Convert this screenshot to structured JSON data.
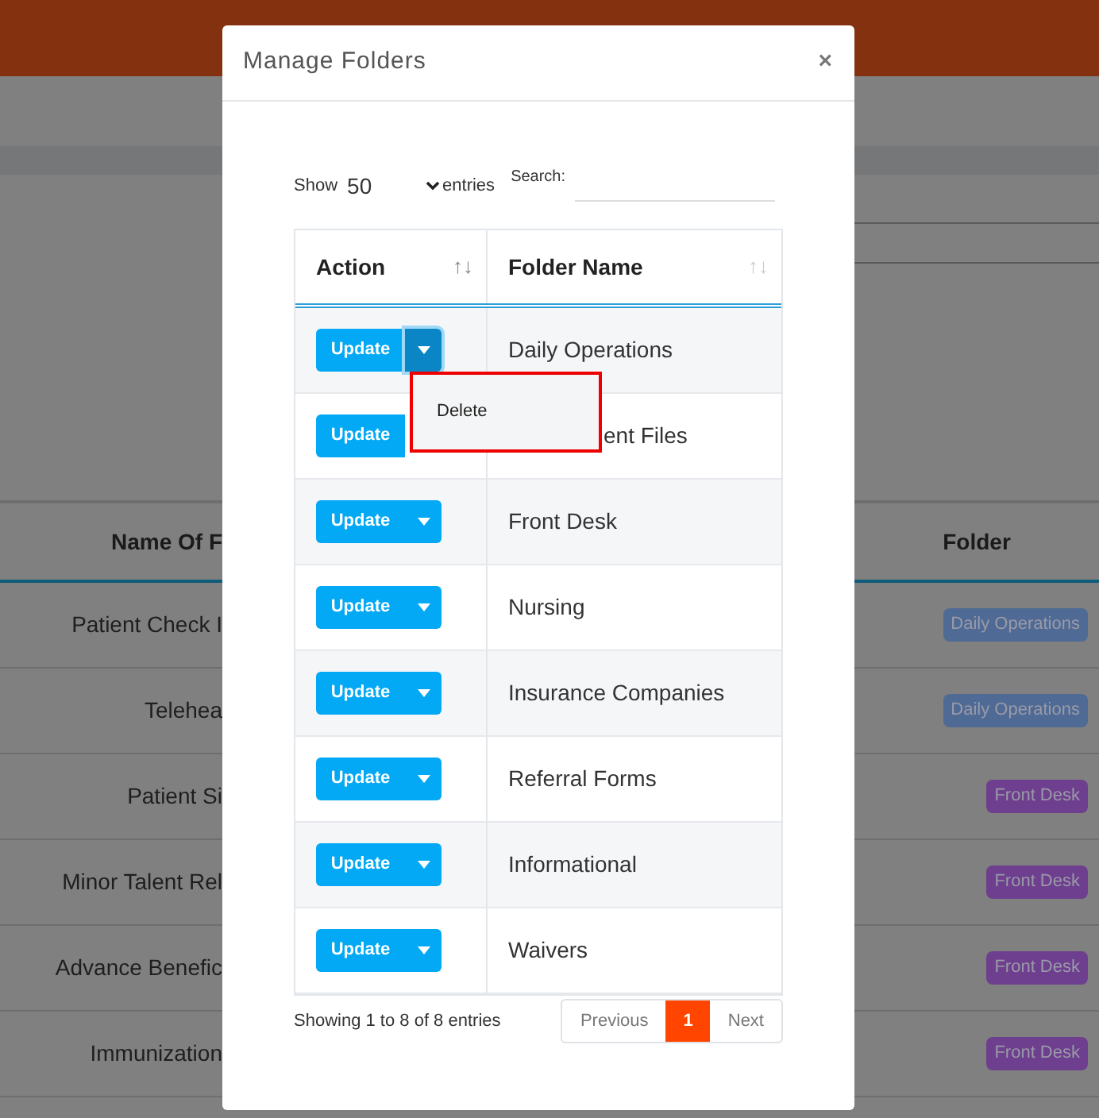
{
  "background": {
    "table": {
      "columns": [
        "Name Of F",
        "Folder"
      ],
      "rows": [
        {
          "name": "Patient Check I",
          "folder": "Daily Operations",
          "color": "#4f6a94"
        },
        {
          "name": "Telehea",
          "folder": "Daily Operations",
          "color": "#4f6a94"
        },
        {
          "name": "Patient Si",
          "folder": "Front Desk",
          "color": "#6e3f8e"
        },
        {
          "name": "Minor Talent Rel",
          "folder": "Front Desk",
          "color": "#6e3f8e"
        },
        {
          "name": "Advance Benefic",
          "folder": "Front Desk",
          "color": "#6e3f8e"
        },
        {
          "name": "Immunization",
          "folder": "Front Desk",
          "color": "#6e3f8e"
        }
      ]
    }
  },
  "modal": {
    "title": "Manage Folders",
    "close": "×",
    "length": {
      "label_before": "Show",
      "value": "50",
      "label_after": "entries"
    },
    "search": {
      "label": "Search:"
    },
    "table": {
      "columns": [
        {
          "label": "Action",
          "sort": "↑↓"
        },
        {
          "label": "Folder Name",
          "sort": "↑↓"
        }
      ],
      "rows": [
        {
          "button": "Update",
          "menu_open": true,
          "name": "Daily Operations"
        },
        {
          "button": "Update",
          "menu_open": false,
          "covered": true,
          "name": "ent Files"
        },
        {
          "button": "Update",
          "menu_open": false,
          "name": "Front Desk"
        },
        {
          "button": "Update",
          "menu_open": false,
          "name": "Nursing"
        },
        {
          "button": "Update",
          "menu_open": false,
          "name": "Insurance Companies"
        },
        {
          "button": "Update",
          "menu_open": false,
          "name": "Referral Forms"
        },
        {
          "button": "Update",
          "menu_open": false,
          "name": "Informational"
        },
        {
          "button": "Update",
          "menu_open": false,
          "name": "Waivers"
        }
      ]
    },
    "menu": {
      "items": [
        "Delete"
      ]
    },
    "info": "Showing 1 to 8 of 8 entries",
    "pagination": [
      {
        "label": "Previous",
        "selected": false
      },
      {
        "label": "1",
        "selected": true
      },
      {
        "label": "Next",
        "selected": false
      }
    ]
  }
}
